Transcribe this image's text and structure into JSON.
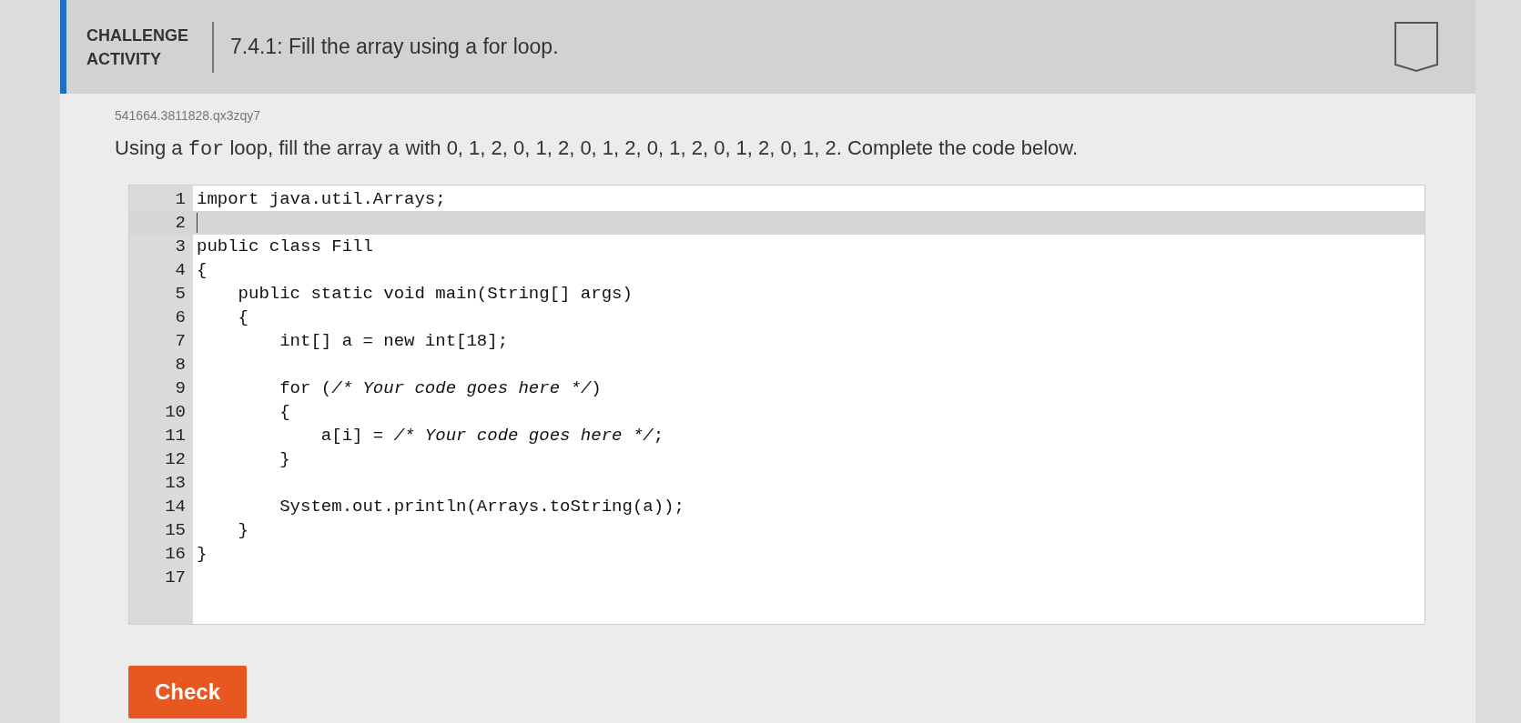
{
  "header": {
    "label_lines": [
      "CHALLENGE",
      "ACTIVITY"
    ],
    "title": "7.4.1: Fill the array using a for loop."
  },
  "activity_id": "541664.3811828.qx3zqy7",
  "prompt": [
    {
      "kind": "text",
      "text": "Using a "
    },
    {
      "kind": "code",
      "text": "for"
    },
    {
      "kind": "text",
      "text": " loop, fill the array "
    },
    {
      "kind": "code",
      "text": "a"
    },
    {
      "kind": "text",
      "text": " with 0, 1, 2, 0, 1, 2, 0, 1, 2, 0, 1, 2, 0, 1, 2, 0, 1, 2. Complete the code below."
    }
  ],
  "editor": {
    "lines": [
      {
        "number": "1",
        "code": "import java.util.Arrays;",
        "selected": false
      },
      {
        "number": "2",
        "selected": true
      },
      {
        "number": "3",
        "code": "public class Fill",
        "selected": false
      },
      {
        "number": "4",
        "code": "{",
        "selected": false
      },
      {
        "number": "5",
        "code": "    public static void main(String[] args)",
        "selected": false
      },
      {
        "number": "6",
        "code": "    {",
        "selected": false
      },
      {
        "number": "7",
        "code": "        int[] a = new int[18];",
        "selected": false
      },
      {
        "number": "8",
        "selected": false
      },
      {
        "number": "9",
        "code": "        for (/* Your code goes here */)",
        "selected": false
      },
      {
        "number": "10",
        "code": "        {",
        "selected": false
      },
      {
        "number": "11",
        "code": "            a[i] = /* Your code goes here */;",
        "selected": false
      },
      {
        "number": "12",
        "code": "        }",
        "selected": false
      },
      {
        "number": "13",
        "selected": false
      },
      {
        "number": "14",
        "code": "        System.out.println(Arrays.toString(a));",
        "selected": false
      },
      {
        "number": "15",
        "code": "    }",
        "selected": false
      },
      {
        "number": "16",
        "code": "}",
        "selected": false
      },
      {
        "number": "17",
        "selected": false
      }
    ]
  },
  "check_button": "Check"
}
